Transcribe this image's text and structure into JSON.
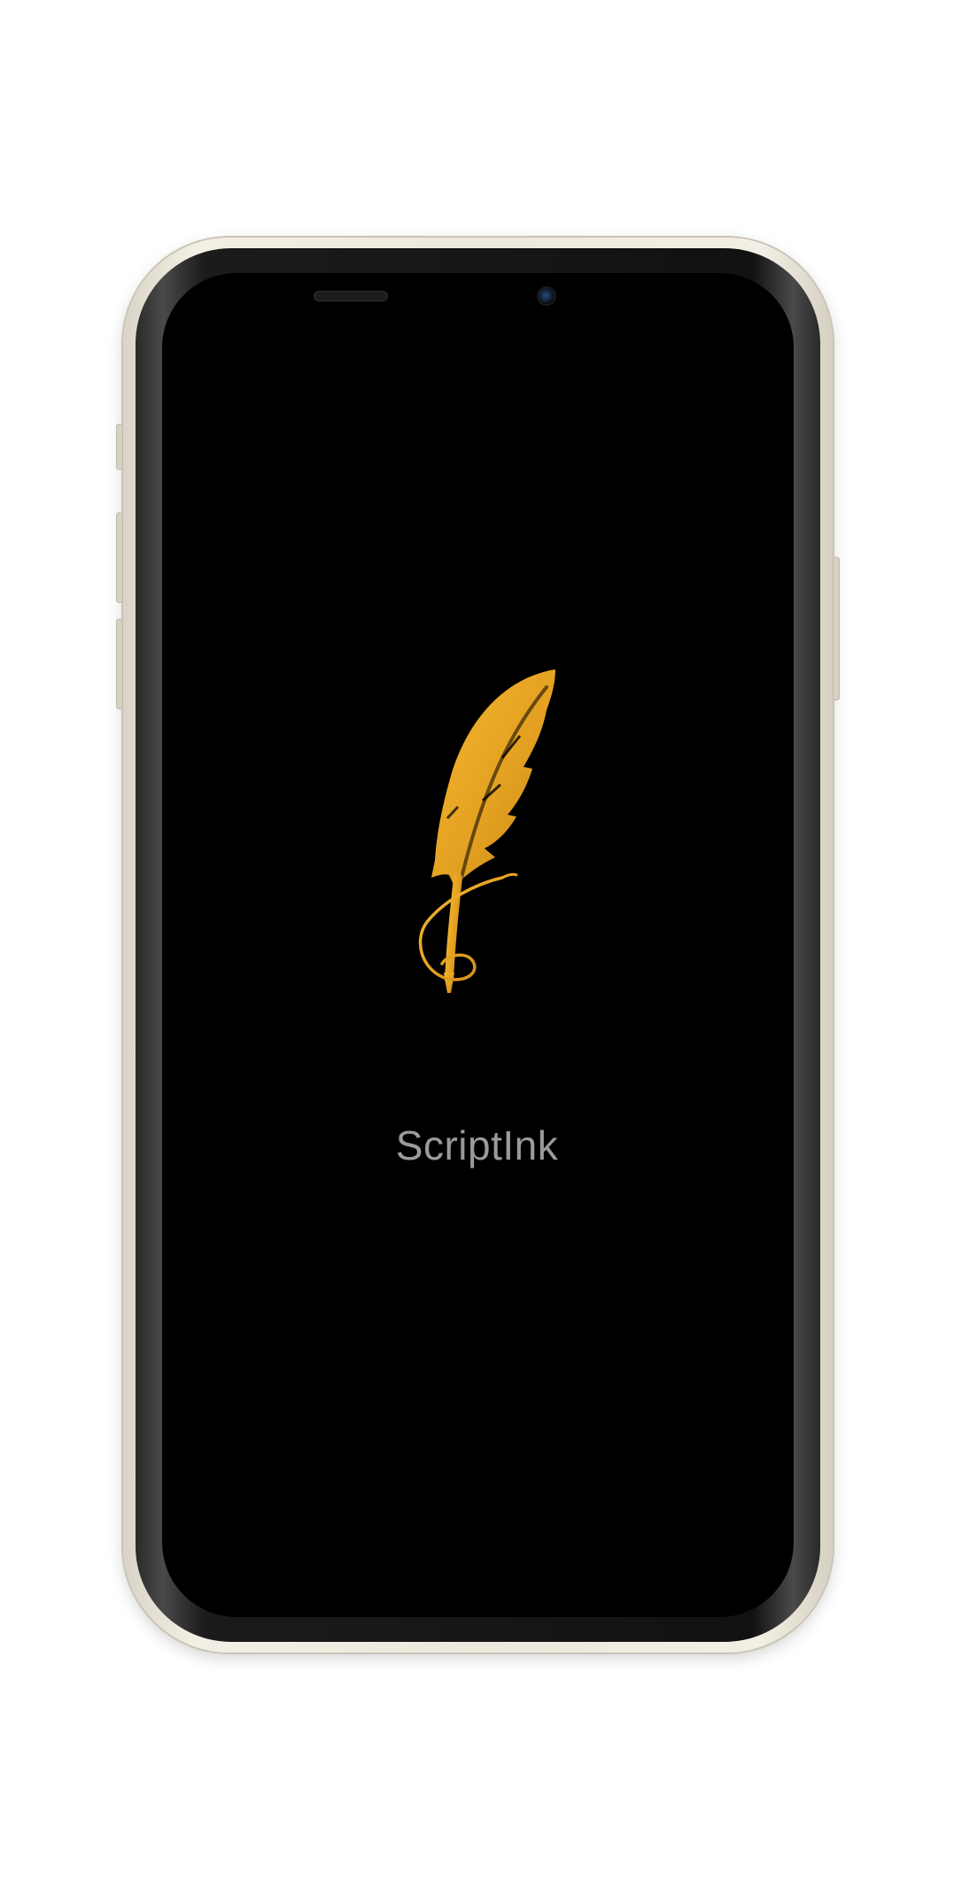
{
  "app": {
    "name": "ScriptInk"
  },
  "logo": {
    "icon": "quill-feather-icon",
    "color": "#E6A323"
  },
  "device": {
    "frame_color": "#EEEADF",
    "screen_color": "#000000"
  }
}
